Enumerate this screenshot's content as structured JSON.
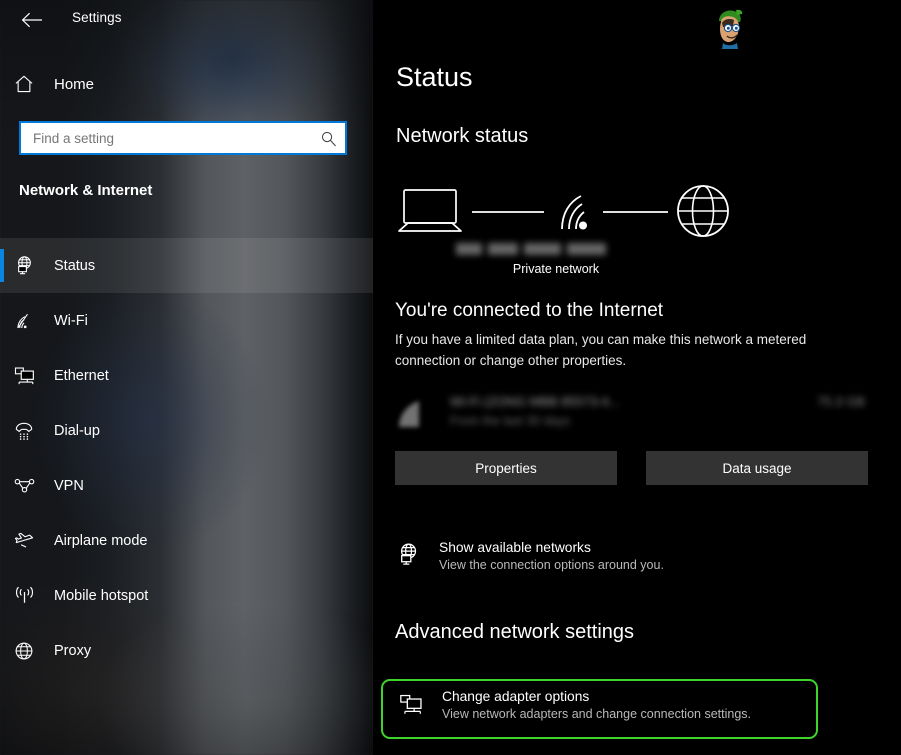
{
  "window": {
    "title": "Settings",
    "back_icon": "back-arrow-icon"
  },
  "sidebar": {
    "home": {
      "label": "Home",
      "icon": "home-icon"
    },
    "search": {
      "placeholder": "Find a setting",
      "value": "",
      "icon": "search-icon"
    },
    "category_title": "Network & Internet",
    "items": [
      {
        "label": "Status",
        "icon": "network-status-icon",
        "selected": true
      },
      {
        "label": "Wi-Fi",
        "icon": "wifi-icon",
        "selected": false
      },
      {
        "label": "Ethernet",
        "icon": "ethernet-icon",
        "selected": false
      },
      {
        "label": "Dial-up",
        "icon": "dialup-phone-icon",
        "selected": false
      },
      {
        "label": "VPN",
        "icon": "vpn-icon",
        "selected": false
      },
      {
        "label": "Airplane mode",
        "icon": "airplane-icon",
        "selected": false
      },
      {
        "label": "Mobile hotspot",
        "icon": "hotspot-icon",
        "selected": false
      },
      {
        "label": "Proxy",
        "icon": "globe-icon",
        "selected": false
      }
    ]
  },
  "main": {
    "page_title": "Status",
    "network_status_heading": "Network status",
    "network_map": {
      "device_icon": "laptop-icon",
      "link_icon": "wifi-signal-icon",
      "internet_icon": "globe-icon",
      "ssid_redacted": "████ ████ █████ ███",
      "caption": "Private network"
    },
    "connection_heading": "You're connected to the Internet",
    "connection_description": "If you have a limited data plan, you can make this network a metered connection or change other properties.",
    "usage": {
      "icon": "wifi-usage-icon",
      "network_name_redacted": "Wi-Fi (ZONG MBB 85573-4...",
      "period_redacted": "From the last 30 days",
      "amount_redacted": "75.3 GB"
    },
    "buttons": {
      "properties": "Properties",
      "data_usage": "Data usage"
    },
    "show_networks": {
      "icon": "network-status-icon",
      "title": "Show available networks",
      "description": "View the connection options around you."
    },
    "advanced_heading": "Advanced network settings",
    "change_adapter": {
      "icon": "ethernet-icon",
      "title": "Change adapter options",
      "description": "View network adapters and change connection settings.",
      "highlighted": true
    },
    "watermark": {
      "icon": "mascot-logo"
    }
  },
  "colors": {
    "accent_blue": "#0078D7",
    "highlight_green": "#3FD42B",
    "button_gray": "#333333",
    "main_bg": "#000000"
  }
}
